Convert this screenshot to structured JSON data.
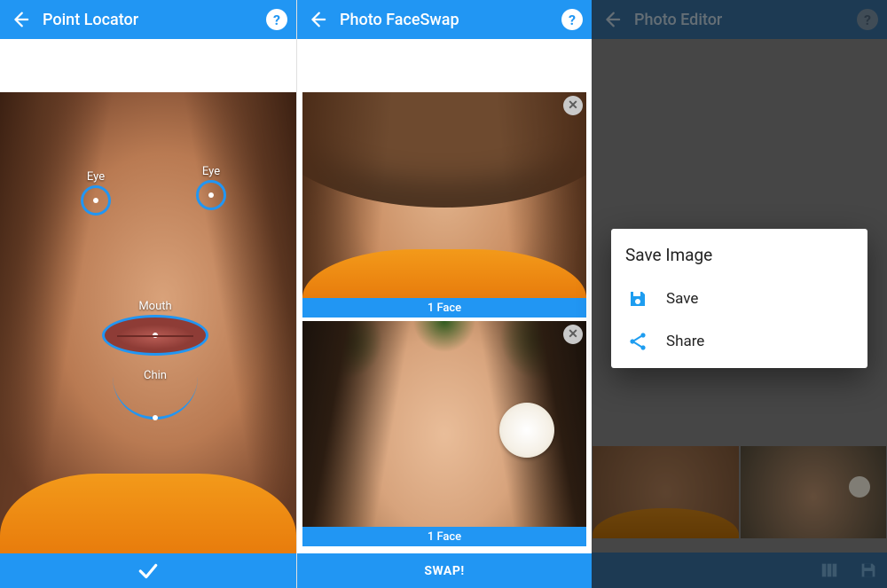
{
  "colors": {
    "accent": "#2196f3"
  },
  "panel1": {
    "title": "Point Locator",
    "markers": {
      "left_eye": "Eye",
      "right_eye": "Eye",
      "mouth": "Mouth",
      "chin": "Chin"
    },
    "confirm_icon": "check-icon"
  },
  "panel2": {
    "title": "Photo FaceSwap",
    "cards": [
      {
        "face_label": "1 Face",
        "close_icon": "close-icon"
      },
      {
        "face_label": "1 Face",
        "close_icon": "close-icon"
      }
    ],
    "swap_button": "SWAP!"
  },
  "panel3": {
    "title": "Photo Editor",
    "bottom_icons": {
      "columns": "columns-icon",
      "save": "save-icon"
    },
    "dialog": {
      "title": "Save Image",
      "items": [
        {
          "icon": "save-icon",
          "label": "Save"
        },
        {
          "icon": "share-icon",
          "label": "Share"
        }
      ]
    }
  }
}
